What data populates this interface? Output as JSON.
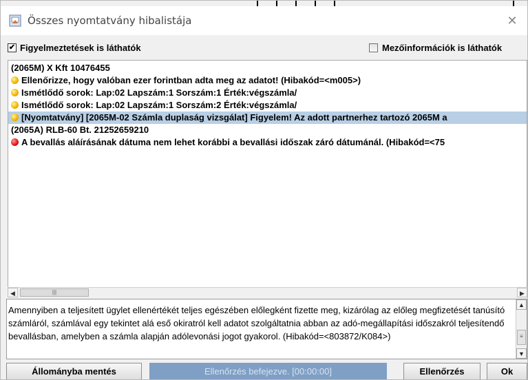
{
  "window": {
    "title": "Összes nyomtatvány hibalistája",
    "close_glyph": "✕"
  },
  "options": {
    "warnings_visible": {
      "label": "Figyelmeztetések is láthatók",
      "checked": true
    },
    "field_info_visible": {
      "label": "Mezőinformációk is láthatók",
      "checked": false
    }
  },
  "list": {
    "rows": [
      {
        "text": "(2065M) X Kft 10476455",
        "icon": "none",
        "selected": false
      },
      {
        "text": "Ellenőrizze, hogy valóban ezer forintban adta meg az adatot! (Hibakód=<m005>)",
        "icon": "warning-dot-icon",
        "selected": false
      },
      {
        "text": "Ismétlődő sorok: Lap:02 Lapszám:1 Sorszám:1 Érték:végszámla/",
        "icon": "warning-dot-icon",
        "selected": false
      },
      {
        "text": "Ismétlődő sorok: Lap:02 Lapszám:1 Sorszám:2 Érték:végszámla/",
        "icon": "warning-dot-icon",
        "selected": false
      },
      {
        "text": "[Nyomtatvány] [2065M-02 Számla duplaság vizsgálat]  Figyelem! Az adott partnerhez tartozó 2065M  a",
        "icon": "warning-dot-icon",
        "selected": true
      },
      {
        "text": "(2065A) RLB-60 Bt. 21252659210",
        "icon": "none",
        "selected": false
      },
      {
        "text": "A bevallás aláírásának dátuma nem lehet korábbi a bevallási  időszak záró dátumánál. (Hibakód=<75",
        "icon": "error-dot-icon",
        "selected": false
      }
    ]
  },
  "detail": {
    "text": "Amennyiben a  teljesített ügylet ellenértékét teljes egészében előlegként  fizette meg, kizárólag az előleg megfizetését tanúsító  számláról, számlával egy tekintet alá eső okiratról kell  adatot szolgáltatnia abban az adó-megállapítási időszakról  teljesítendő bevallásban, amelyben a számla alapján  adólevonási jogot gyakorol.  (Hibakód=<803872/K084>)"
  },
  "footer": {
    "save_label": "Állományba mentés",
    "status_text": "Ellenőrzés befejezve. [00:00:00]",
    "check_label": "Ellenőrzés",
    "ok_label": "Ok"
  },
  "colors": {
    "selected_row": "#b8cfe5",
    "status_bar": "#7f9fc5",
    "warning_dot": "#f5b800",
    "error_dot": "#e21b1b"
  }
}
